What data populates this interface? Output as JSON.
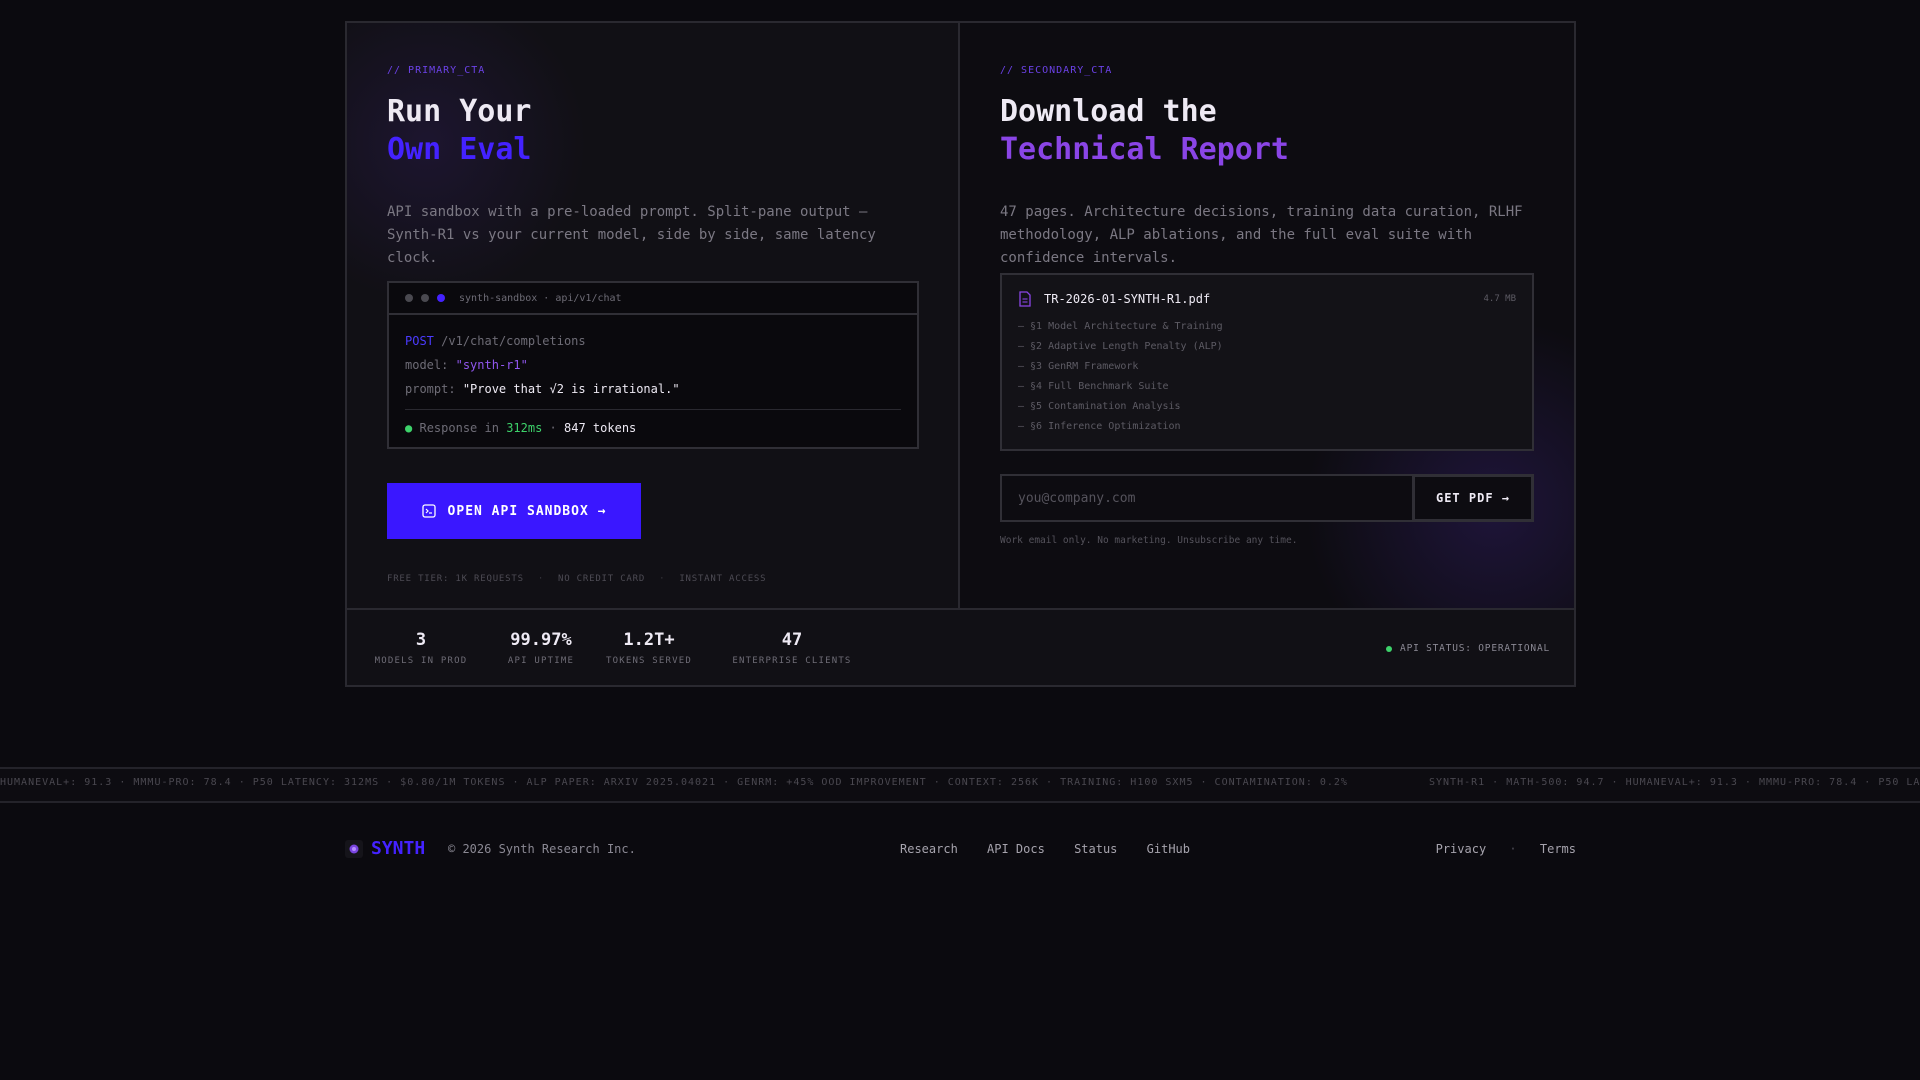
{
  "primary": {
    "tag": "// PRIMARY_CTA",
    "title_line1": "Run Your",
    "title_line2": "Own Eval",
    "description": "API sandbox with a pre-loaded prompt. Split-pane output — Synth-R1 vs your current model, side by side, same latency clock.",
    "terminal": {
      "title": "synth-sandbox · api/v1/chat",
      "method": "POST",
      "endpoint": "/v1/chat/completions",
      "model_key": "model:",
      "model_value": "\"synth-r1\"",
      "prompt_key": "prompt:",
      "prompt_value": "\"Prove that √2 is irrational.\"",
      "response_prefix": "Response in",
      "response_time": "312ms",
      "response_sep": "·",
      "response_tokens": "847 tokens"
    },
    "button_label": "OPEN API SANDBOX →",
    "perks": [
      "FREE TIER: 1K REQUESTS",
      "NO CREDIT CARD",
      "INSTANT ACCESS"
    ]
  },
  "secondary": {
    "tag": "// SECONDARY_CTA",
    "title_line1": "Download the",
    "title_line2": "Technical Report",
    "description": "47 pages. Architecture decisions, training data curation, RLHF methodology, ALP ablations, and the full eval suite with confidence intervals.",
    "file": {
      "name": "TR-2026-01-SYNTH-R1.pdf",
      "size": "4.7 MB",
      "toc": [
        "— §1 Model Architecture & Training",
        "— §2 Adaptive Length Penalty (ALP)",
        "— §3 GenRM Framework",
        "— §4 Full Benchmark Suite",
        "— §5 Contamination Analysis",
        "— §6 Inference Optimization"
      ]
    },
    "email_placeholder": "you@company.com",
    "button_label": "GET PDF →",
    "fine_print": "Work email only. No marketing. Unsubscribe any time."
  },
  "stats": [
    {
      "value": "3",
      "label": "MODELS IN PROD"
    },
    {
      "value": "99.97%",
      "label": "API UPTIME"
    },
    {
      "value": "1.2T+",
      "label": "TOKENS SERVED"
    },
    {
      "value": "47",
      "label": "ENTERPRISE CLIENTS"
    }
  ],
  "api_status": "API STATUS: OPERATIONAL",
  "ticker": {
    "segment_a": "HUMANEVAL+: 91.3 · MMMU-PRO: 78.4 · P50 LATENCY: 312MS · $0.80/1M TOKENS · ALP PAPER: ARXIV 2025.04021 · GENRM: +45% OOD IMPROVEMENT · CONTEXT: 256K · TRAINING: H100 SXM5 · CONTAMINATION: 0.2%",
    "segment_b": "SYNTH-R1 · MATH-500: 94.7 · HUMANEVAL+: 91.3 · MMMU-PRO: 78.4 · P50 LA"
  },
  "footer": {
    "brand": "SYNTH",
    "copyright": "© 2026 Synth Research Inc.",
    "links": [
      "Research",
      "API Docs",
      "Status",
      "GitHub"
    ],
    "privacy": "Privacy",
    "legal_sep": "·",
    "terms": "Terms"
  },
  "colors": {
    "accent_blue": "#3a17ff",
    "accent_violet": "#8a45e6",
    "status_green": "#3dd26a",
    "background": "#0b0a0f"
  }
}
